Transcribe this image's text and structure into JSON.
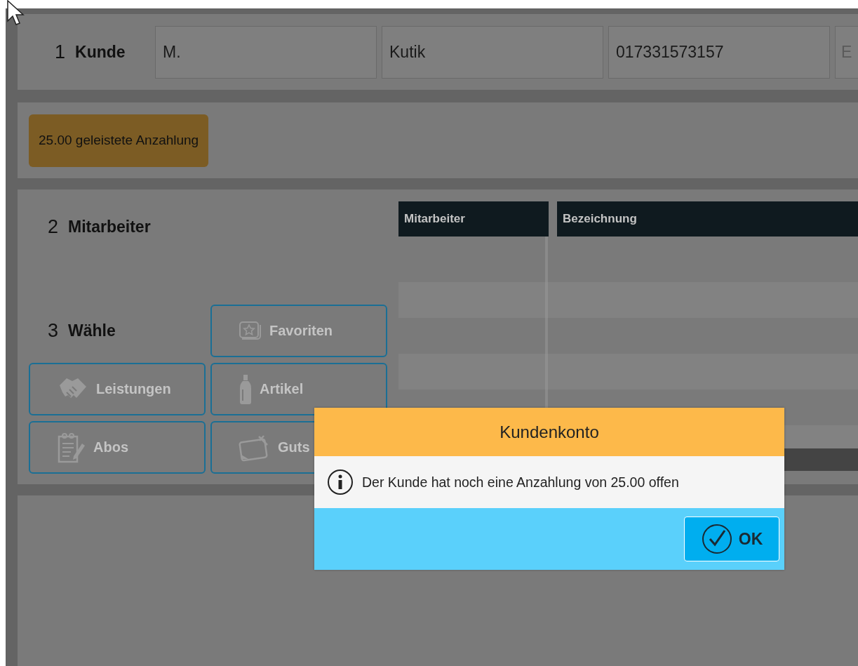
{
  "customer": {
    "step": "1",
    "label": "Kunde",
    "fields": [
      {
        "value": "M."
      },
      {
        "value": "Kutik"
      },
      {
        "value": "017331573157"
      },
      {
        "placeholder": "E"
      }
    ]
  },
  "deposit_badge": "25.00 geleistete Anzahlung",
  "employee": {
    "step": "2",
    "label": "Mitarbeiter"
  },
  "choose": {
    "step": "3",
    "label": "Wähle",
    "buttons": [
      {
        "label": "Favoriten",
        "kind": "favorites"
      },
      {
        "label": "Leistungen",
        "kind": "services"
      },
      {
        "label": "Artikel",
        "kind": "articles"
      },
      {
        "label": "Abos",
        "kind": "subscriptions"
      },
      {
        "label": "Guts",
        "kind": "vouchers"
      }
    ]
  },
  "table": {
    "columns": [
      "Mitarbeiter",
      "Bezeichnung"
    ]
  },
  "dialog": {
    "title": "Kundenkonto",
    "message": "Der Kunde hat noch eine Anzahlung von 25.00 offen",
    "ok_button": "OK"
  }
}
